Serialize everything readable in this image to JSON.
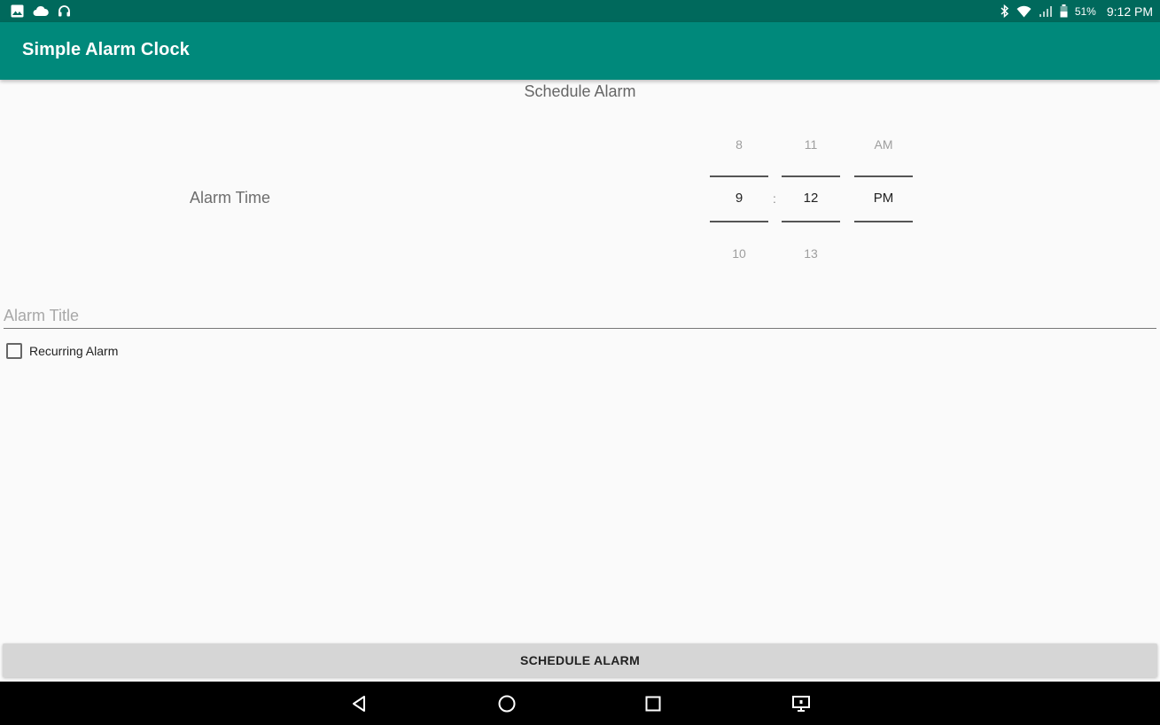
{
  "status_bar": {
    "left_icons": [
      "image-icon",
      "cloud-icon",
      "headset-icon"
    ],
    "right_icons": [
      "bluetooth-icon",
      "wifi-icon",
      "signal-icon",
      "battery-icon"
    ],
    "battery": "51%",
    "time": "9:12 PM",
    "background": "#00695c"
  },
  "app_bar": {
    "title": "Simple Alarm Clock",
    "background": "#00897b"
  },
  "main": {
    "section_title": "Schedule Alarm",
    "alarm_time_label": "Alarm Time",
    "picker": {
      "hour": {
        "prev": "8",
        "value": "9",
        "next": "10"
      },
      "separator": ":",
      "minute": {
        "prev": "11",
        "value": "12",
        "next": "13"
      },
      "ampm": {
        "prev": "AM",
        "value": "PM",
        "next": ""
      }
    },
    "title_field": {
      "placeholder": "Alarm Title",
      "value": ""
    },
    "recurring": {
      "label": "Recurring Alarm",
      "checked": false
    },
    "schedule_button": "SCHEDULE ALARM"
  },
  "nav_bar": {
    "buttons": [
      "back-icon",
      "home-icon",
      "recents-icon",
      "cast-icon"
    ]
  }
}
